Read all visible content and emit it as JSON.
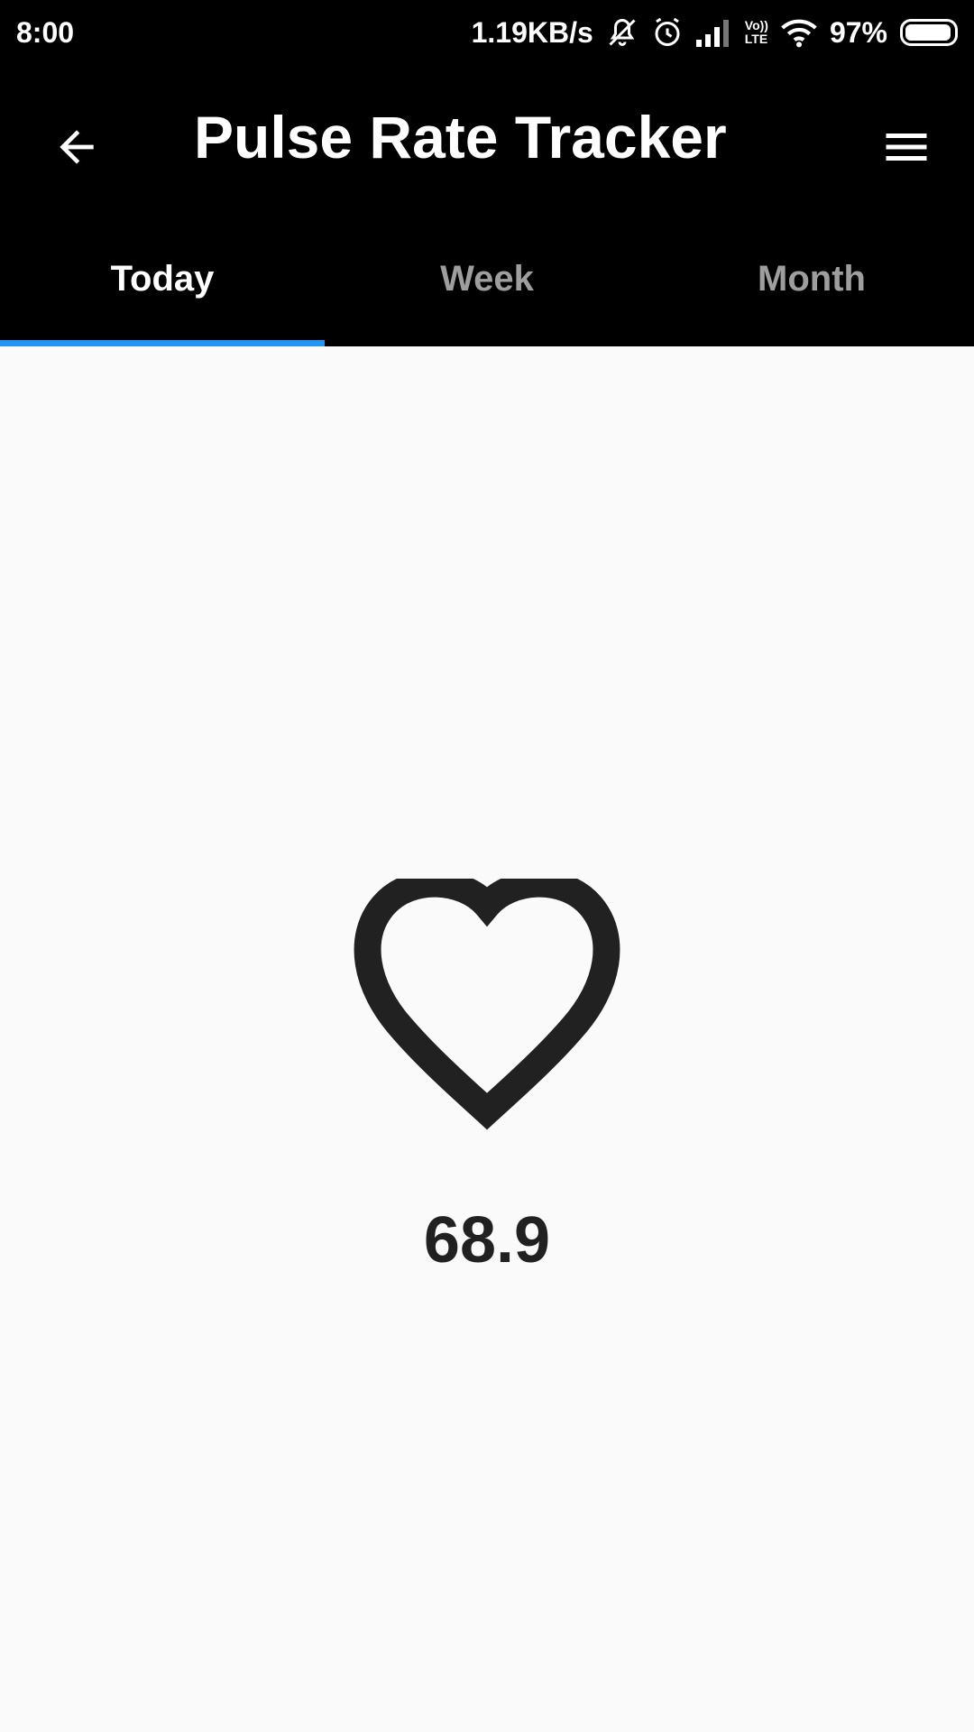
{
  "status_bar": {
    "time": "8:00",
    "network_speed": "1.19KB/s",
    "volte_label_top": "Vo))",
    "volte_label_bottom": "LTE",
    "battery_percent": "97%",
    "battery_level": 0.97,
    "icons": [
      "mute-icon",
      "alarm-icon",
      "signal-icon",
      "volte-icon",
      "wifi-icon",
      "battery-icon"
    ]
  },
  "app_bar": {
    "title": "Pulse Rate Tracker",
    "back_icon": "arrow-back-icon",
    "menu_icon": "hamburger-menu-icon"
  },
  "tabs": [
    {
      "label": "Today",
      "active": true
    },
    {
      "label": "Week",
      "active": false
    },
    {
      "label": "Month",
      "active": false
    }
  ],
  "main": {
    "icon": "heart-outline-icon",
    "pulse_value": "68.9"
  },
  "colors": {
    "app_bar_bg": "#000000",
    "tab_indicator": "#2196f3",
    "content_bg": "#fafafa",
    "text_dark": "#212121",
    "tab_inactive": "#9e9e9e"
  }
}
